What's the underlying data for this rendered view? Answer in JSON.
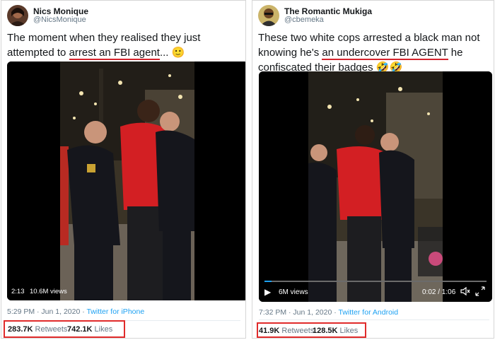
{
  "left": {
    "name": "Nics Monique",
    "handle": "@NicsMonique",
    "text_before": "The moment when they realised they just attempted to ",
    "text_highlight": "arrest an FBI agent",
    "text_after": "... ",
    "emoji": "🙂",
    "video_time": "2:13",
    "video_views": "10.6M views",
    "timestamp": "5:29 PM · Jun 1, 2020 · ",
    "source": "Twitter for iPhone",
    "retweets_count": "283.7K",
    "retweets_label": "Retweets",
    "likes_count": "742.1K",
    "likes_label": "Likes"
  },
  "right": {
    "name": "The Romantic Mukiga",
    "handle": "@cbemeka",
    "text_before": "These two white cops arrested a black man not knowing he's ",
    "text_highlight": "an undercover FBI AGENT",
    "text_after": " he confiscated their badges ",
    "emoji": "🤣🤣",
    "video_views": "6M views",
    "video_progress": "0:02 / 1:06",
    "timestamp": "7:32 PM · Jun 1, 2020 · ",
    "source": "Twitter for Android",
    "retweets_count": "41.9K",
    "retweets_label": "Retweets",
    "likes_count": "128.5K",
    "likes_label": "Likes"
  },
  "icons": {
    "play": "play-icon",
    "mute": "volume-muted-icon",
    "fullscreen": "fullscreen-icon"
  },
  "colors": {
    "highlight_underline": "#d4242c",
    "stats_box": "#e02b2b",
    "link": "#1da1f2"
  }
}
